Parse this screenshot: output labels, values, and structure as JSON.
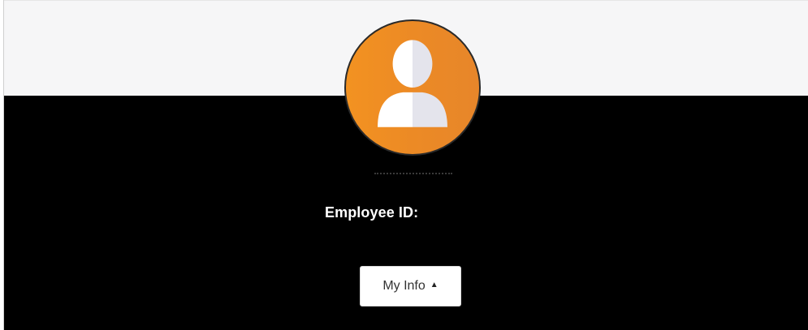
{
  "profile": {
    "employee_id_label": "Employee ID:",
    "employee_id_value": "",
    "avatar_icon": "user-silhouette-icon"
  },
  "actions": {
    "my_info_label": "My Info",
    "my_info_caret": "▲"
  },
  "colors": {
    "avatar_bg": "#f39221",
    "header_bg": "#f6f6f7",
    "card_bg": "#000000",
    "button_bg": "#ffffff"
  }
}
